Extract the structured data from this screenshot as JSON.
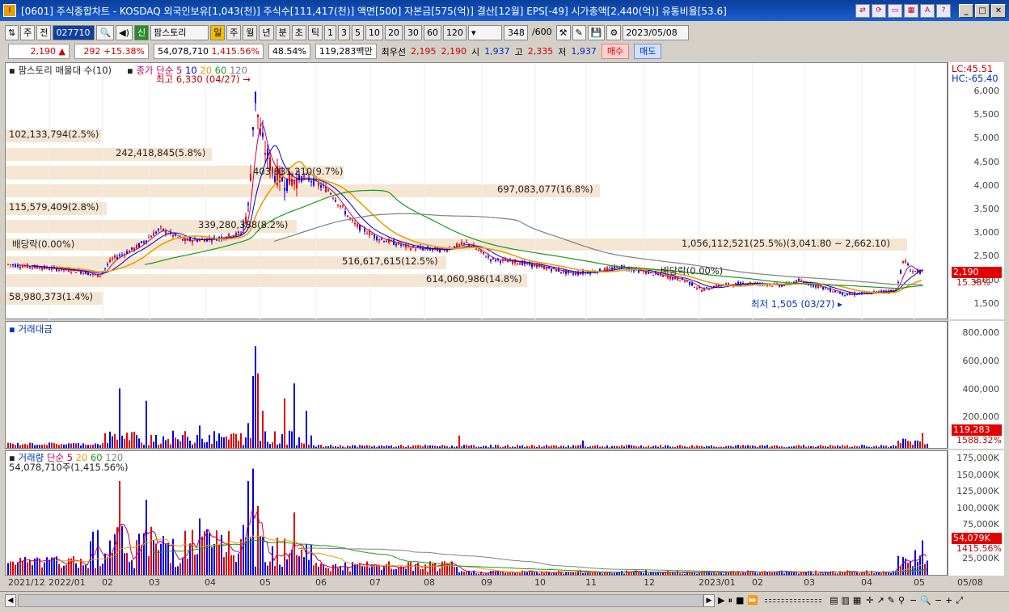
{
  "window": {
    "title": "[0601] 주식종합차트 - KOSDAQ 외국인보유[1,043(천)] 주식수[111,417(천)] 액면[500] 자본금[575(억)] 결산[12월] EPS[-49] 시가총액[2,440(억)] 유통비율[53.6]"
  },
  "toolbar": {
    "market": "주",
    "market2": "전",
    "code": "027710",
    "theme": "신",
    "theme_name": "팜스토리",
    "periods": [
      "일",
      "주",
      "월",
      "년",
      "분",
      "초",
      "틱"
    ],
    "intervals": [
      "1",
      "3",
      "5",
      "10",
      "20",
      "30",
      "60",
      "120"
    ],
    "count": "348",
    "count_max": "/600",
    "date": "2023/05/08"
  },
  "info": {
    "price": "2,190",
    "arrow": "▲",
    "change": "292",
    "change_pct": "+15.38%",
    "volume": "54,078,710",
    "vol_pct": "1,415.56%",
    "rate": "48.54%",
    "amount": "119,283백만",
    "best_label": "최우선",
    "ask": "2,195",
    "bid": "2,190",
    "open_label": "시",
    "open": "1,937",
    "high_label": "고",
    "high": "2,335",
    "low_label": "저",
    "low": "1,937",
    "buy": "매수",
    "sell": "매도"
  },
  "price_panel": {
    "legend_name": "팜스토리 매물대 수(10)",
    "ma_label": "종가 단순",
    "ma": [
      "5",
      "10",
      "20",
      "60",
      "120"
    ],
    "lc": "LC:45.51",
    "hc": "HC:-65.40",
    "max_label": "최고 6,330 (04/27)",
    "min_label": "최저 1,505 (03/27)",
    "dividend1": "배당락(0.00%)",
    "dividend2": "배당락(0.00%)",
    "last_price": "2,190",
    "last_pct": "15.38%",
    "yticks": [
      "6,000",
      "5,500",
      "5,000",
      "4,500",
      "4,000",
      "3,500",
      "3,000",
      "2,500",
      "2,000",
      "1,500"
    ],
    "volume_profile": [
      "102,133,794(2.5%)",
      "242,418,845(5.8%)",
      "403,831,210(9.7%)",
      "697,083,077(16.8%)",
      "115,579,409(2.8%)",
      "339,280,388(8.2%)",
      "1,056,112,521(25.5%)(3,041.80 ~ 2,662.10)",
      "516,617,615(12.5%)",
      "614,060,986(14.8%)",
      "58,980,373(1.4%)"
    ]
  },
  "amount_panel": {
    "title": "거래대금",
    "yticks": [
      "800,000",
      "600,000",
      "400,000",
      "200,000"
    ],
    "last": "119,283",
    "last_pct": "1588.32%"
  },
  "volume_panel": {
    "title": "거래량",
    "ma_label": "단순",
    "ma": [
      "5",
      "20",
      "60",
      "120"
    ],
    "summary": "54,078,710주(1,415.56%)",
    "yticks": [
      "175,000K",
      "150,000K",
      "125,000K",
      "100,000K",
      "75,000K",
      "50,000K",
      "25,000K"
    ],
    "last": "54,079K",
    "last_pct": "1415.56%"
  },
  "xaxis": [
    "2021/12",
    "2022/01",
    "02",
    "03",
    "04",
    "05",
    "06",
    "07",
    "08",
    "09",
    "10",
    "11",
    "12",
    "2023/01",
    "02",
    "03",
    "04",
    "05",
    "05/08"
  ],
  "colors": {
    "up": "#e00000",
    "down": "#0000e0",
    "ma5": "#c00060",
    "ma20": "#e8a000",
    "ma60": "#1a9a1a",
    "ma120": "#808080",
    "profile": "#f5e6d3"
  }
}
